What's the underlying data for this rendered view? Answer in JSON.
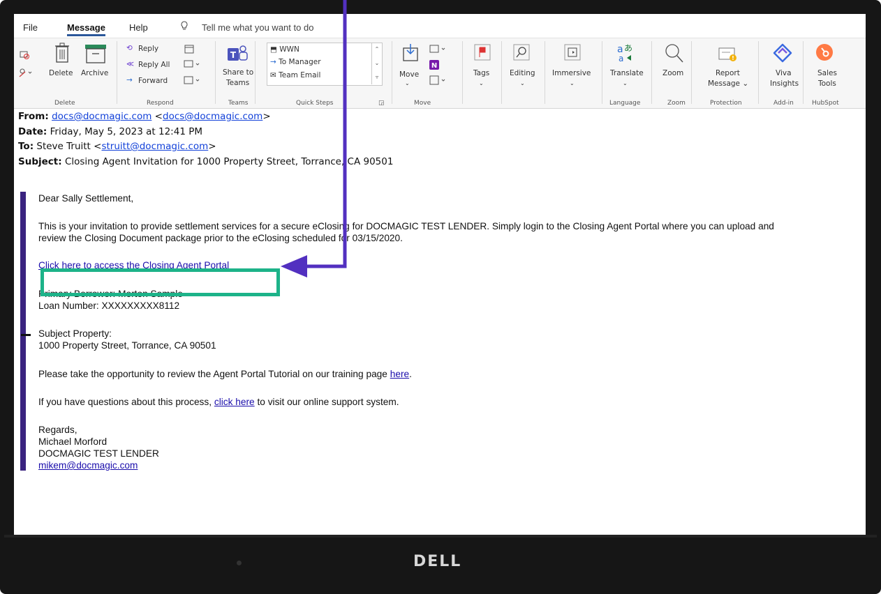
{
  "menu": {
    "tabs": [
      "File",
      "Message",
      "Help"
    ],
    "tell_me": "Tell me what you want to do"
  },
  "ribbon": {
    "delete_group": {
      "delete": "Delete",
      "archive": "Archive",
      "label": "Delete"
    },
    "respond_group": {
      "reply": "Reply",
      "reply_all": "Reply All",
      "forward": "Forward",
      "label": "Respond"
    },
    "teams_group": {
      "share_line1": "Share to",
      "share_line2": "Teams",
      "label": "Teams"
    },
    "quick_steps": {
      "items": [
        "WWN",
        "To Manager",
        "Team Email"
      ],
      "label": "Quick Steps"
    },
    "move_group": {
      "move": "Move",
      "label": "Move"
    },
    "tags": "Tags",
    "editing": "Editing",
    "immersive": "Immersive",
    "language_group": {
      "translate": "Translate",
      "label": "Language"
    },
    "zoom_group": {
      "zoom": "Zoom",
      "label": "Zoom"
    },
    "protection_group": {
      "report_line1": "Report",
      "report_line2": "Message",
      "label": "Protection"
    },
    "addin_group": {
      "viva_line1": "Viva",
      "viva_line2": "Insights",
      "label": "Add-in"
    },
    "hubspot_group": {
      "sales_line1": "Sales",
      "sales_line2": "Tools",
      "label": "HubSpot"
    }
  },
  "headers": {
    "from_label": "From:",
    "from_name": "docs@docmagic.com",
    "from_email": "docs@docmagic.com",
    "date_label": "Date:",
    "date_value": "Friday, May 5, 2023 at 12:41 PM",
    "to_label": "To:",
    "to_name": "Steve Truitt",
    "to_email": "struitt@docmagic.com",
    "subject_label": "Subject:",
    "subject_value": "Closing Agent Invitation for 1000 Property Street, Torrance, CA 90501"
  },
  "body": {
    "greeting": "Dear Sally Settlement,",
    "invite_line1": "This is your invitation to provide settlement services for a secure eClosing for DOCMAGIC TEST LENDER. Simply login to the Closing Agent Portal where you can upload and",
    "invite_line2": "review the Closing Document package prior to the eClosing scheduled for 03/15/2020.",
    "portal_link": "Click here to access the Closing Agent Portal",
    "borrower": "Primary Borrower: Morton Sample",
    "loan": "Loan Number: XXXXXXXXX8112",
    "property_label": "Subject Property:",
    "property_value": "1000 Property Street, Torrance, CA 90501",
    "tutorial_text": "Please take the opportunity to review the Agent Portal Tutorial on our training page ",
    "tutorial_link": "here",
    "tutorial_end": ".",
    "questions_text": "If you have questions about this process, ",
    "questions_link": "click here",
    "questions_end": " to visit our online support system.",
    "regards": "Regards,",
    "sender_name": "Michael Morford",
    "sender_company": "DOCMAGIC TEST LENDER",
    "sender_email": "mikem@docmagic.com"
  },
  "monitor": {
    "brand": "DELL"
  },
  "colors": {
    "accent": "#2b579a",
    "callout_box": "#1db389",
    "arrow": "#5230c0",
    "quote_bar": "#3a237f",
    "link": "#1a0dab"
  }
}
